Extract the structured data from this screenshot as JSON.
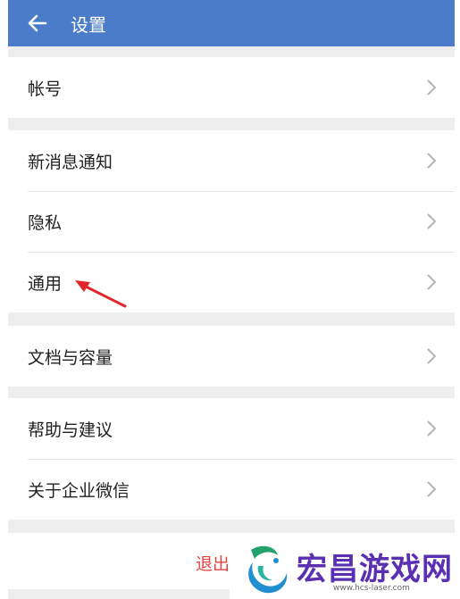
{
  "header": {
    "title": "设置",
    "back_icon": "arrow-left-icon"
  },
  "groups": [
    {
      "items": [
        {
          "label": "帐号"
        }
      ]
    },
    {
      "items": [
        {
          "label": "新消息通知"
        },
        {
          "label": "隐私"
        },
        {
          "label": "通用"
        }
      ]
    },
    {
      "items": [
        {
          "label": "文档与容量"
        }
      ]
    },
    {
      "items": [
        {
          "label": "帮助与建议"
        },
        {
          "label": "关于企业微信"
        }
      ]
    }
  ],
  "logout": {
    "label": "退出"
  },
  "watermark": {
    "title": "宏昌游戏网",
    "url": "www.hcs-laser.com"
  },
  "colors": {
    "header": "#4a7cc9",
    "logout": "#e64340",
    "annotation_arrow": "#e0262a",
    "watermark": "#5a2fb2"
  }
}
